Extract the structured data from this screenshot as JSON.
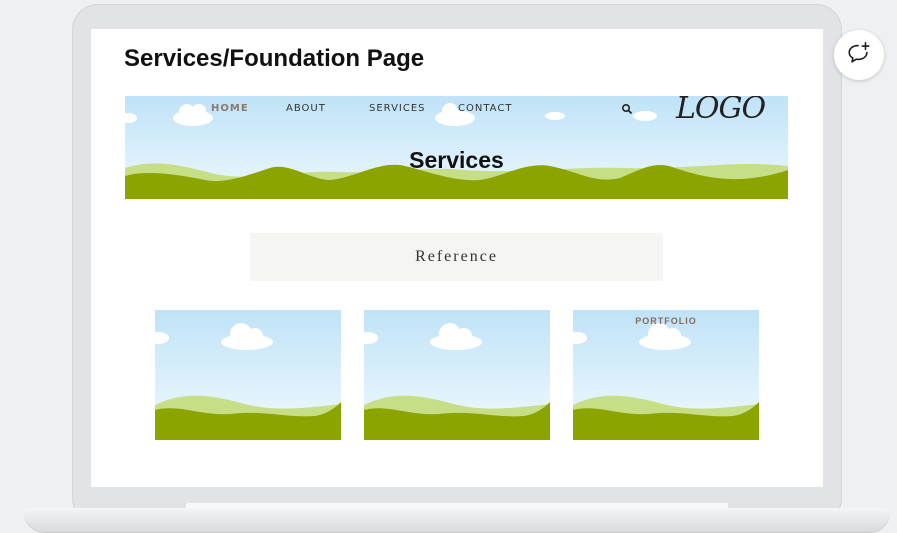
{
  "page": {
    "title": "Services/Foundation Page"
  },
  "hero": {
    "nav": [
      "HOME",
      "ABOUT",
      "SERVICES",
      "CONTACT"
    ],
    "logo_text": "LOGO",
    "heading": "Services"
  },
  "reference_block": {
    "text": "Reference"
  },
  "cards": [
    {
      "label": ""
    },
    {
      "label": ""
    },
    {
      "label": "PORTFOLIO"
    }
  ],
  "colors": {
    "sky_top": "#bfe3f7",
    "sky_bottom": "#eef8ff",
    "hill_dark": "#8ba400",
    "hill_light": "#c6df86",
    "label_brown": "#8a6a5a"
  },
  "icons": {
    "search": "search-icon",
    "comment": "add-comment-icon"
  }
}
